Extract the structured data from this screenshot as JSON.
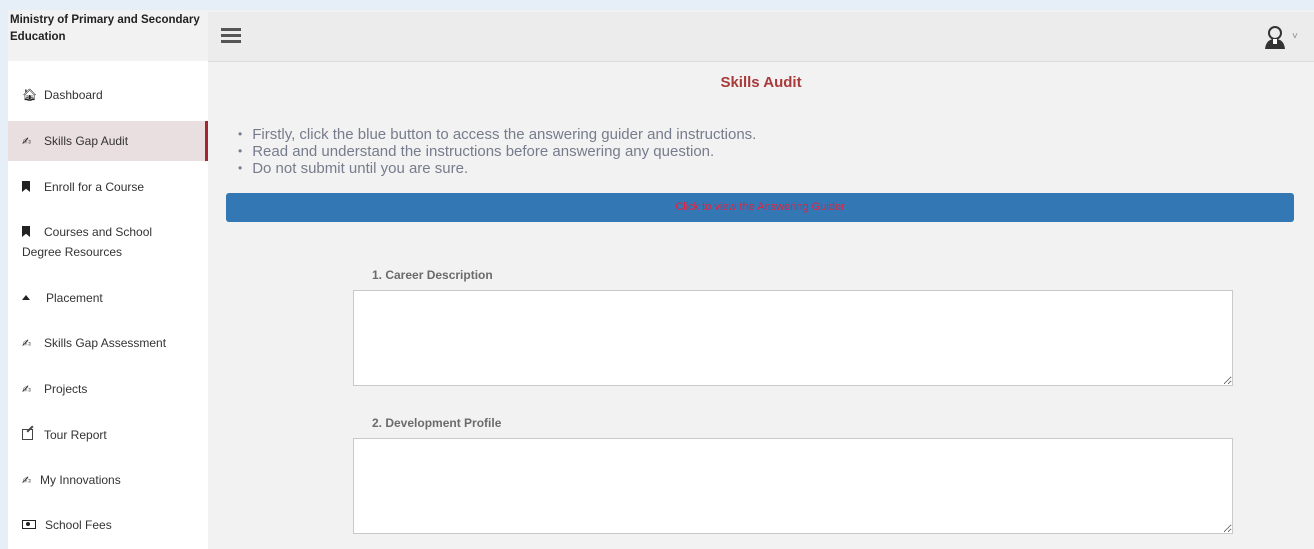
{
  "app": {
    "brand": "Ministry of Primary and Secondary Education"
  },
  "sidebar": {
    "items": [
      {
        "label": "Dashboard",
        "icon": "home-icon"
      },
      {
        "label": "Skills Gap Audit",
        "icon": "signature-icon",
        "active": true
      },
      {
        "label": "Enroll for a Course",
        "icon": "bookmark-icon"
      },
      {
        "label": "Courses and School Degree Resources",
        "icon": "bookmark-icon"
      },
      {
        "label": "Placement",
        "icon": "caret-up-icon"
      },
      {
        "label": "Skills Gap Assessment",
        "icon": "signature-icon"
      },
      {
        "label": "Projects",
        "icon": "signature-icon"
      },
      {
        "label": "Tour Report",
        "icon": "edit-icon"
      },
      {
        "label": "My Innovations",
        "icon": "signature-icon"
      },
      {
        "label": "School Fees",
        "icon": "money-icon"
      }
    ]
  },
  "header": {
    "menu_icon": "hamburger-icon",
    "user_icon": "user-avatar-icon",
    "user_caret": "˅"
  },
  "main": {
    "title": "Skills Audit",
    "instructions": [
      "Firstly, click the blue button to access the answering guider and instructions.",
      "Read and understand the instructions before answering any question.",
      "Do not submit until you are sure."
    ],
    "guide_button": "Click to view the Answering Guider",
    "fields": [
      {
        "label": "1. Career Description",
        "value": ""
      },
      {
        "label": "2. Development Profile",
        "value": ""
      }
    ]
  },
  "colors": {
    "accent_title": "#a83a3a",
    "button_bg": "#3477b5",
    "button_text": "#e8203a",
    "active_marker": "#a5262c"
  }
}
